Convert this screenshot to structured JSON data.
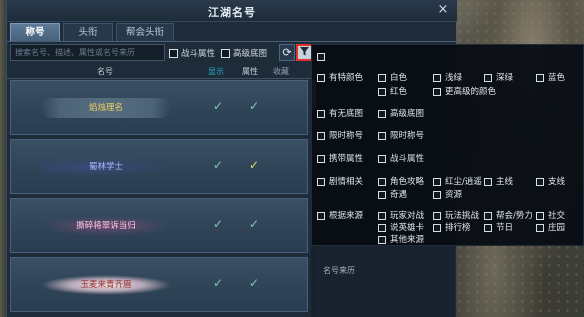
{
  "window": {
    "title": "江湖名号",
    "close": "×"
  },
  "tabs": [
    {
      "label": "称号",
      "active": true
    },
    {
      "label": "头衔",
      "active": false
    },
    {
      "label": "帮会头衔",
      "active": false
    }
  ],
  "toolbar": {
    "search_placeholder": "搜索名号、描述、属性或名号来历",
    "combat_attr": "战斗属性",
    "premium_bg": "高级底图",
    "refresh_icon": "⟳",
    "filter_icon": "filter-icon"
  },
  "columns": {
    "name": "名号",
    "show": "显示",
    "attr": "属性",
    "fav": "收藏"
  },
  "rows": [
    {
      "name": "焰烛理名",
      "show_check": "✓",
      "attr_check": "✓"
    },
    {
      "name": "蜀林学士",
      "show_check": "✓",
      "attr_check": "✓"
    },
    {
      "name": "撕碎将翠诉当归",
      "show_check": "✓",
      "attr_check": "✓"
    },
    {
      "name": "玉麦来青齐眉",
      "show_check": "✓",
      "attr_check": "✓"
    }
  ],
  "filter_panel": {
    "groups": [
      {
        "label": "有特颜色",
        "options": [
          "白色",
          "浅绿",
          "深绿",
          "蓝色",
          "红色",
          "更高级的颜色"
        ]
      },
      {
        "label": "有无底图",
        "options": [
          "高级底图"
        ]
      },
      {
        "label": "限时称号",
        "options": [
          "限时称号"
        ]
      },
      {
        "label": "携带属性",
        "options": [
          "战斗属性"
        ]
      },
      {
        "label": "剧情相关",
        "options": [
          "角色攻略",
          "红尘/逍遥",
          "主线",
          "支线",
          "奇遇",
          "资源"
        ]
      },
      {
        "label": "根据来源",
        "options": [
          "玩家对战",
          "玩法挑战",
          "帮会/势力",
          "社交",
          "说英雄卡",
          "排行榜",
          "节日",
          "庄园",
          "其他来源"
        ]
      }
    ],
    "footer_label": "名号来历"
  },
  "colors": {
    "accent": "#2aa8c8",
    "check": "#7fc8b4",
    "check_yellow": "#d7e058",
    "filter_border": "#e2302a"
  }
}
